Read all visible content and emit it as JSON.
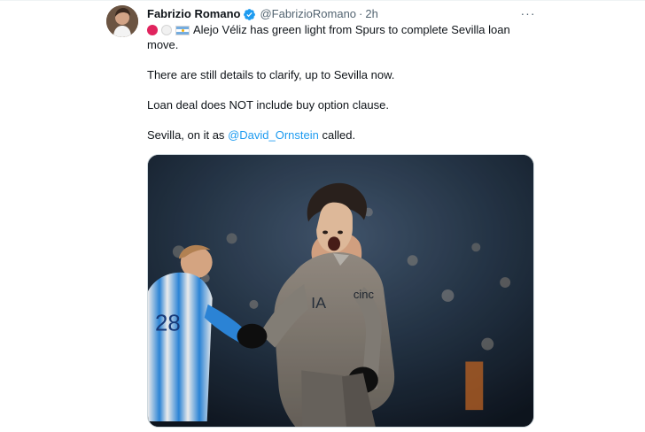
{
  "tweet": {
    "author": {
      "display_name": "Fabrizio Romano",
      "handle": "@FabrizioRomano",
      "time": "2h",
      "separator": "·",
      "avatar_icon": "avatar-photo-icon",
      "verified_icon": "verified-badge-icon"
    },
    "more_icon": "more-options-icon",
    "more_label": "···",
    "flags": [
      "red-circle-emoji",
      "white-circle-emoji",
      "argentina-flag-emoji"
    ],
    "lines": [
      "Alejo Véliz has green light from Spurs to complete Sevilla loan",
      "move.",
      "There are still details to clarify, up to Sevilla now.",
      "Loan deal does NOT include buy option clause.",
      "Sevilla, on it as",
      "called."
    ],
    "mention": "@David_Ornstein",
    "media": {
      "alt": "Football player celebrating in a stadium",
      "colors": {
        "background": "#243446",
        "player_jersey": "#8d857a",
        "opponent_jersey": "#2f8fe8",
        "brand_accent": "#1d9bf0"
      }
    }
  }
}
